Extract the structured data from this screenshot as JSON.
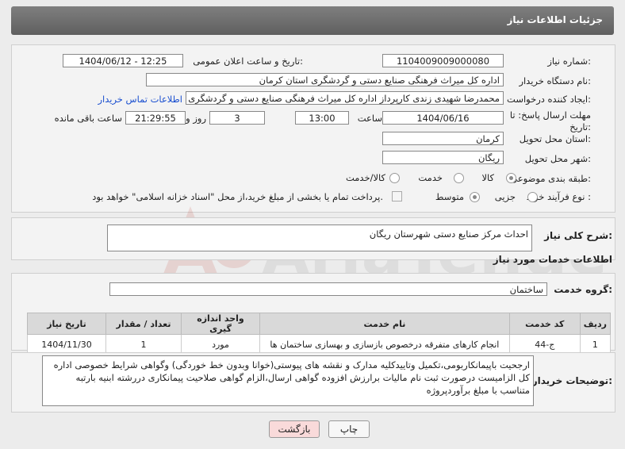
{
  "header": {
    "title": "جزئیات اطلاعات نیاز"
  },
  "form": {
    "need_number_label": "شماره نیاز:",
    "need_number": "1104009009000080",
    "announce_label": "تاریخ و ساعت اعلان عمومی:",
    "announce_value": "1404/06/12 - 12:25",
    "buyer_org_label": "نام دستگاه خریدار:",
    "buyer_org": "اداره کل میراث فرهنگی  صنایع دستی و گردشگری استان کرمان",
    "requester_label": "ایجاد کننده درخواست:",
    "requester": "محمدرضا شهیدی زندی کارپرداز اداره کل میراث فرهنگی  صنایع دستی و گردشگری استان کرمان",
    "contact_link": "اطلاعات تماس خریدار",
    "deadline_label_1": "مهلت ارسال پاسخ: تا",
    "deadline_label_2": "تاریخ:",
    "deadline_date": "1404/06/16",
    "time_label": "ساعت",
    "deadline_time": "13:00",
    "days_value": "3",
    "days_label": "روز و",
    "remaining_time": "21:29:55",
    "remaining_label": "ساعت باقی مانده",
    "province_label": "استان محل تحویل:",
    "province": "کرمان",
    "city_label": "شهر محل تحویل:",
    "city": "ریگان",
    "category_label": "طبقه بندی موضوعی:",
    "category_options": [
      "کالا",
      "خدمت",
      "کالا/خدمت"
    ],
    "process_label": "نوع فرآیند خرید :",
    "process_options": [
      "جزیی",
      "متوسط"
    ],
    "payment_note": "پرداخت تمام یا بخشی از مبلغ خرید،از محل \"اسناد خزانه اسلامی\" خواهد بود."
  },
  "summary": {
    "label": "شرح کلی نیاز:",
    "value": "احداث مرکز صنایع دستی شهرستان ریگان"
  },
  "services": {
    "section_title": "اطلاعات خدمات مورد نیاز",
    "group_label": "گروه خدمت:",
    "group_value": "ساختمان",
    "columns": [
      "ردیف",
      "کد خدمت",
      "نام خدمت",
      "واحد اندازه گیری",
      "تعداد / مقدار",
      "تاریخ نیاز"
    ],
    "rows": [
      [
        "1",
        "ج-44",
        "انجام کارهای متفرقه درخصوص بازسازی و بهسازی ساختمان ها",
        "مورد",
        "1",
        "1404/11/30"
      ]
    ]
  },
  "buyer_notes": {
    "label": "توضیحات خریدار:",
    "value": "ارجحیت باپیمانکاربومی،تکمیل وتاییدکلیه مدارک و نقشه های پیوستی(خوانا وبدون خط خوردگی) وگواهی شرایط خصوصی اداره کل الزامیست درصورت ثبت نام مالیات برارزش افزوده گواهی ارسال،الزام گواهی صلاحیت پیمانکاری دررشته ابنیه بارتبه متناسب با مبلغ برآوردپروژه"
  },
  "buttons": {
    "print": "چاپ",
    "back": "بازگشت"
  },
  "watermark": {
    "text": "AriaTender.net"
  },
  "colors": {
    "header": "#6f6f6f",
    "back_button": "#f9dada",
    "link": "#1a4fd0"
  }
}
